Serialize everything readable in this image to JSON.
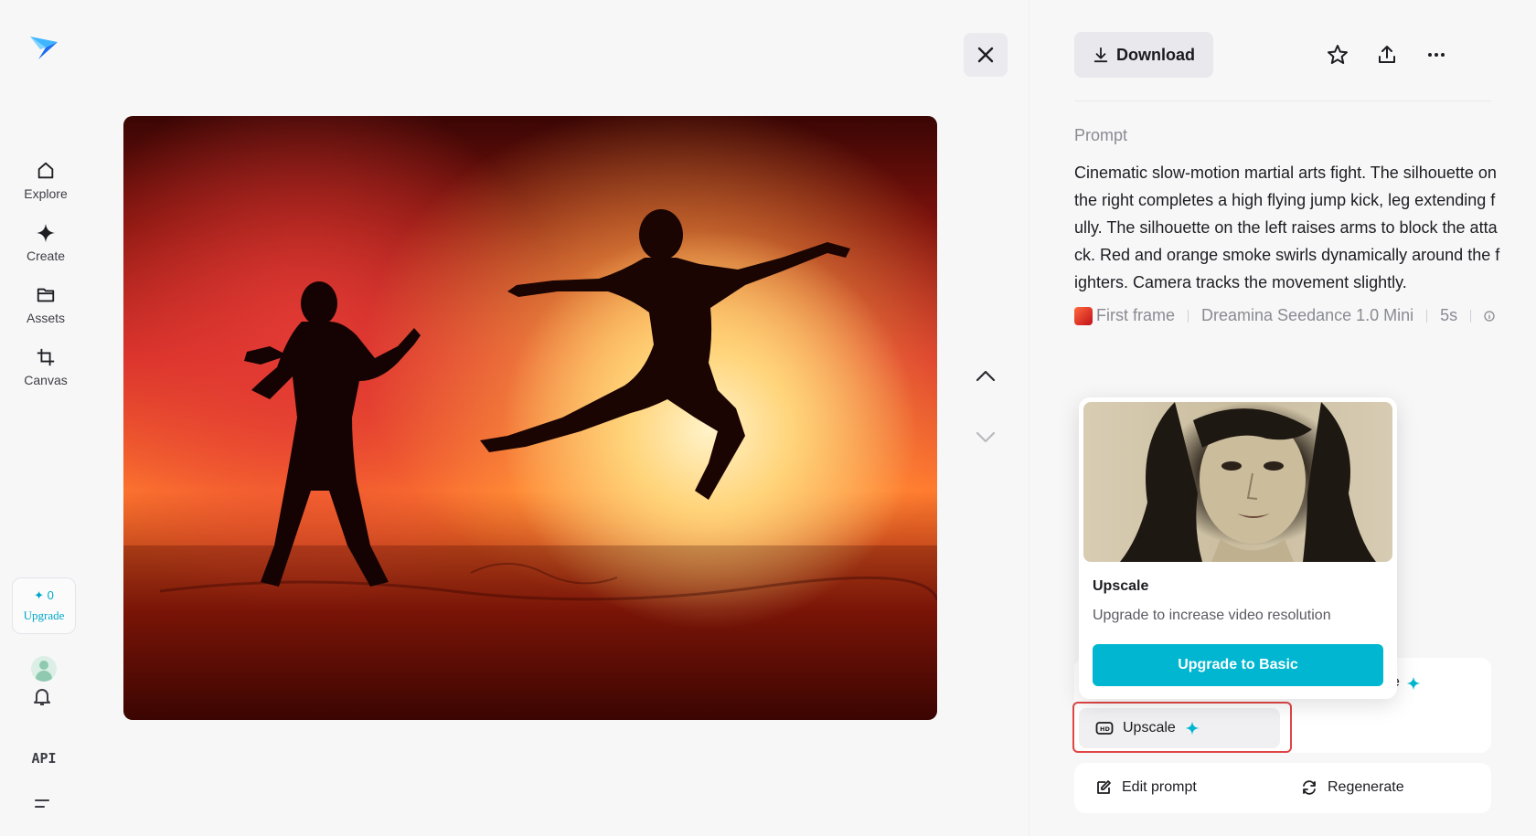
{
  "sidebar": {
    "items": [
      {
        "label": "Explore",
        "icon": "home-icon"
      },
      {
        "label": "Create",
        "icon": "sparkle-icon"
      },
      {
        "label": "Assets",
        "icon": "folder-icon"
      },
      {
        "label": "Canvas",
        "icon": "crop-icon"
      }
    ],
    "credits": {
      "count": "0",
      "upgrade_label": "Upgrade"
    },
    "api_label": "API"
  },
  "toolbar": {
    "download_label": "Download"
  },
  "prompt": {
    "label": "Prompt",
    "text": "Cinematic slow-motion martial arts fight. The silhouette on the right completes a high flying jump kick, leg extending fully. The silhouette on the left raises arms to block the attack. Red and orange smoke swirls dynamically around the fighters. Camera tracks the movement slightly."
  },
  "meta": {
    "first_frame": "First frame",
    "model": "Dreamina Seedance 1.0 Mini",
    "duration": "5s"
  },
  "popover": {
    "title": "Upscale",
    "description": "Upgrade to increase video resolution",
    "cta": "Upgrade to Basic"
  },
  "actions": {
    "upscale": "Upscale",
    "edit_prompt": "Edit prompt",
    "regenerate": "Regenerate",
    "peek_text": "e"
  },
  "colors": {
    "accent": "#00b6d0",
    "highlight": "#e04646"
  }
}
